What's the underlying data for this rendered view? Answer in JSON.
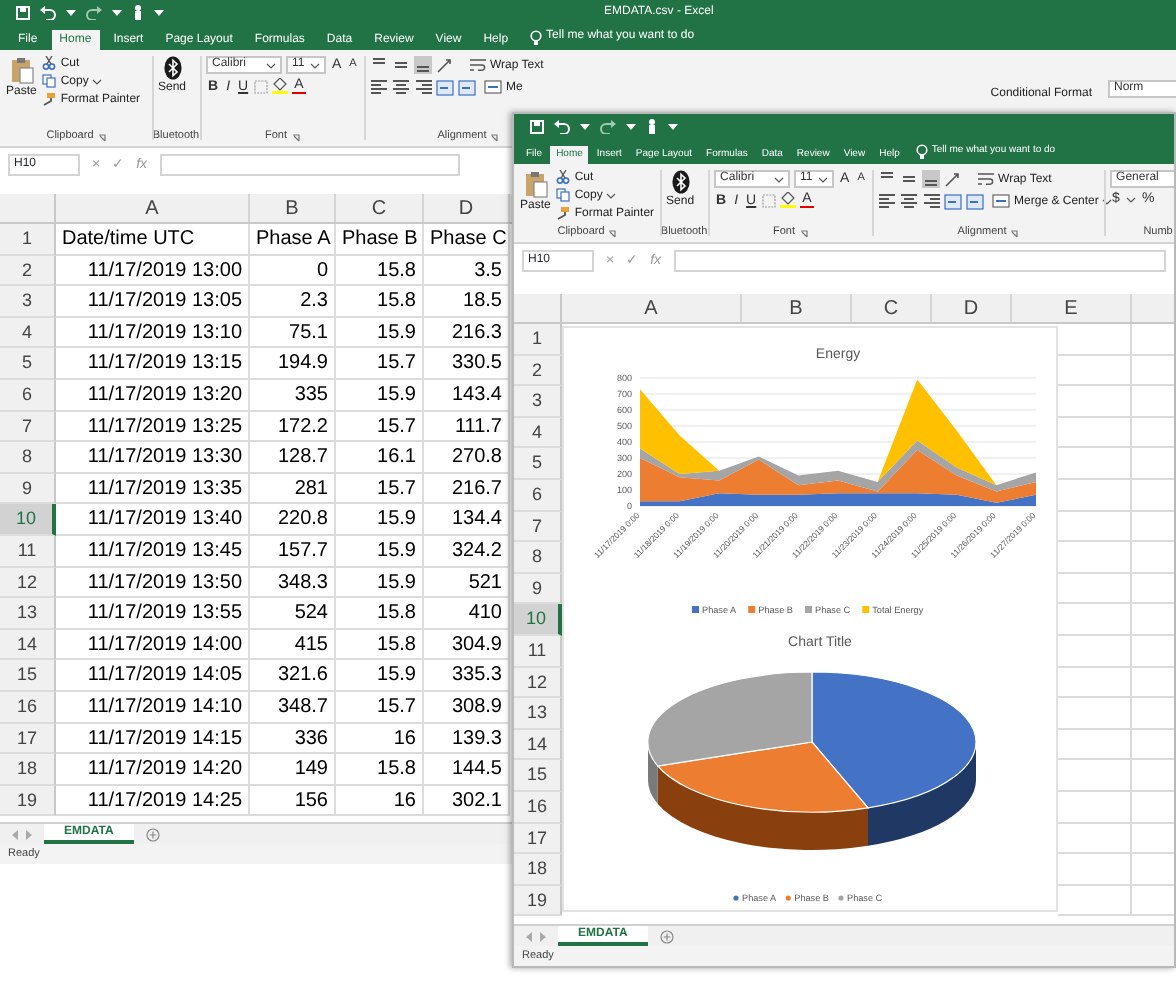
{
  "back_window": {
    "title": "EMDATA.csv - Excel",
    "tabs": [
      {
        "label": "File",
        "selected": false
      },
      {
        "label": "Home",
        "selected": true
      },
      {
        "label": "Insert",
        "selected": false
      },
      {
        "label": "Page Layout",
        "selected": false
      },
      {
        "label": "Formulas",
        "selected": false
      },
      {
        "label": "Data",
        "selected": false
      },
      {
        "label": "Review",
        "selected": false
      },
      {
        "label": "View",
        "selected": false
      },
      {
        "label": "Help",
        "selected": false
      }
    ],
    "tell_me": "Tell me what you want to do",
    "ribbon": {
      "clipboard": {
        "paste": "Paste",
        "cut": "Cut",
        "copy": "Copy",
        "format_painter": "Format Painter",
        "label": "Clipboard"
      },
      "bluetooth": {
        "send": "Send",
        "label": "Bluetooth"
      },
      "font": {
        "name": "Calibri",
        "size": "11",
        "grow": "A",
        "shrink": "A",
        "bold": "B",
        "italic": "I",
        "underline": "U",
        "text_color_button": "A",
        "label": "Font"
      },
      "alignment": {
        "wrap": "Wrap Text",
        "merge": "Me",
        "label": "Alignment"
      },
      "styles": {
        "conditional": "Conditional Format",
        "style_box": "Norm"
      }
    },
    "formula_bar": {
      "name_box": "H10",
      "cancel": "×",
      "enter": "✓",
      "fx": "fx"
    },
    "columns": [
      "A",
      "B",
      "C",
      "D"
    ],
    "rows": [
      {
        "number": "1",
        "selected": false,
        "cells": [
          "Date/time UTC",
          "Phase A",
          "Phase B",
          "Phase C"
        ]
      },
      {
        "number": "2",
        "selected": false,
        "cells": [
          "11/17/2019 13:00",
          "0",
          "15.8",
          "3.5"
        ]
      },
      {
        "number": "3",
        "selected": false,
        "cells": [
          "11/17/2019 13:05",
          "2.3",
          "15.8",
          "18.5"
        ]
      },
      {
        "number": "4",
        "selected": false,
        "cells": [
          "11/17/2019 13:10",
          "75.1",
          "15.9",
          "216.3"
        ]
      },
      {
        "number": "5",
        "selected": false,
        "cells": [
          "11/17/2019 13:15",
          "194.9",
          "15.7",
          "330.5"
        ]
      },
      {
        "number": "6",
        "selected": false,
        "cells": [
          "11/17/2019 13:20",
          "335",
          "15.9",
          "143.4"
        ]
      },
      {
        "number": "7",
        "selected": false,
        "cells": [
          "11/17/2019 13:25",
          "172.2",
          "15.7",
          "111.7"
        ]
      },
      {
        "number": "8",
        "selected": false,
        "cells": [
          "11/17/2019 13:30",
          "128.7",
          "16.1",
          "270.8"
        ]
      },
      {
        "number": "9",
        "selected": false,
        "cells": [
          "11/17/2019 13:35",
          "281",
          "15.7",
          "216.7"
        ]
      },
      {
        "number": "10",
        "selected": true,
        "cells": [
          "11/17/2019 13:40",
          "220.8",
          "15.9",
          "134.4"
        ]
      },
      {
        "number": "11",
        "selected": false,
        "cells": [
          "11/17/2019 13:45",
          "157.7",
          "15.9",
          "324.2"
        ]
      },
      {
        "number": "12",
        "selected": false,
        "cells": [
          "11/17/2019 13:50",
          "348.3",
          "15.9",
          "521"
        ]
      },
      {
        "number": "13",
        "selected": false,
        "cells": [
          "11/17/2019 13:55",
          "524",
          "15.8",
          "410"
        ]
      },
      {
        "number": "14",
        "selected": false,
        "cells": [
          "11/17/2019 14:00",
          "415",
          "15.8",
          "304.9"
        ]
      },
      {
        "number": "15",
        "selected": false,
        "cells": [
          "11/17/2019 14:05",
          "321.6",
          "15.9",
          "335.3"
        ]
      },
      {
        "number": "16",
        "selected": false,
        "cells": [
          "11/17/2019 14:10",
          "348.7",
          "15.7",
          "308.9"
        ]
      },
      {
        "number": "17",
        "selected": false,
        "cells": [
          "11/17/2019 14:15",
          "336",
          "16",
          "139.3"
        ]
      },
      {
        "number": "18",
        "selected": false,
        "cells": [
          "11/17/2019 14:20",
          "149",
          "15.8",
          "144.5"
        ]
      },
      {
        "number": "19",
        "selected": false,
        "cells": [
          "11/17/2019 14:25",
          "156",
          "16",
          "302.1"
        ]
      }
    ],
    "sheet_tabs": [
      {
        "label": "EMDATA",
        "selected": true
      }
    ],
    "status": "Ready"
  },
  "front_window": {
    "tabs": [
      {
        "label": "File",
        "selected": false
      },
      {
        "label": "Home",
        "selected": true
      },
      {
        "label": "Insert",
        "selected": false
      },
      {
        "label": "Page Layout",
        "selected": false
      },
      {
        "label": "Formulas",
        "selected": false
      },
      {
        "label": "Data",
        "selected": false
      },
      {
        "label": "Review",
        "selected": false
      },
      {
        "label": "View",
        "selected": false
      },
      {
        "label": "Help",
        "selected": false
      }
    ],
    "tell_me": "Tell me what you want to do",
    "ribbon": {
      "clipboard": {
        "paste": "Paste",
        "cut": "Cut",
        "copy": "Copy",
        "format_painter": "Format Painter",
        "label": "Clipboard"
      },
      "bluetooth": {
        "send": "Send",
        "label": "Bluetooth"
      },
      "font": {
        "name": "Calibri",
        "size": "11",
        "grow": "A",
        "shrink": "A",
        "bold": "B",
        "italic": "I",
        "underline": "U",
        "text_color_button": "A",
        "label": "Font"
      },
      "alignment": {
        "wrap": "Wrap Text",
        "merge": "Merge & Center",
        "label": "Alignment"
      },
      "number": {
        "format": "General",
        "currency": "$",
        "percent": "%",
        "label": "Numb"
      }
    },
    "formula_bar": {
      "name_box": "H10",
      "cancel": "×",
      "enter": "✓",
      "fx": "fx"
    },
    "columns": [
      "A",
      "B",
      "C",
      "D",
      "E"
    ],
    "rows": [
      {
        "number": "1",
        "selected": false
      },
      {
        "number": "2",
        "selected": false
      },
      {
        "number": "3",
        "selected": false
      },
      {
        "number": "4",
        "selected": false
      },
      {
        "number": "5",
        "selected": false
      },
      {
        "number": "6",
        "selected": false
      },
      {
        "number": "7",
        "selected": false
      },
      {
        "number": "8",
        "selected": false
      },
      {
        "number": "9",
        "selected": false
      },
      {
        "number": "10",
        "selected": true
      },
      {
        "number": "11",
        "selected": false
      },
      {
        "number": "12",
        "selected": false
      },
      {
        "number": "13",
        "selected": false
      },
      {
        "number": "14",
        "selected": false
      },
      {
        "number": "15",
        "selected": false
      },
      {
        "number": "16",
        "selected": false
      },
      {
        "number": "17",
        "selected": false
      },
      {
        "number": "18",
        "selected": false
      },
      {
        "number": "19",
        "selected": false
      }
    ],
    "energy_chart": {
      "chart_data": {
        "type": "area",
        "title": "Energy",
        "stacked": true,
        "grid": true,
        "legend": "bottom",
        "ylim": [
          0,
          800
        ],
        "yticks": [
          0,
          100,
          200,
          300,
          400,
          500,
          600,
          700,
          800
        ],
        "categories": [
          "11/17/2019 0:00",
          "11/18/2019 0:00",
          "11/19/2019 0:00",
          "11/20/2019 0:00",
          "11/21/2019 0:00",
          "11/22/2019 0:00",
          "11/23/2019 0:00",
          "11/24/2019 0:00",
          "11/25/2019 0:00",
          "11/26/2019 0:00",
          "11/27/2019 0:00"
        ],
        "series": [
          {
            "name": "Phase A",
            "color": "#4472c4",
            "values": [
              30,
              30,
              80,
              70,
              70,
              80,
              80,
              80,
              70,
              20,
              70
            ]
          },
          {
            "name": "Phase B",
            "color": "#ed7d31",
            "values": [
              270,
              150,
              80,
              220,
              60,
              80,
              10,
              270,
              120,
              70,
              80
            ]
          },
          {
            "name": "Phase C",
            "color": "#a5a5a5",
            "values": [
              60,
              20,
              60,
              20,
              60,
              60,
              60,
              60,
              50,
              40,
              60
            ]
          },
          {
            "name": "Total Energy",
            "color": "#ffc000",
            "values": [
              370,
              240,
              0,
              0,
              0,
              0,
              0,
              380,
              230,
              0,
              0
            ]
          }
        ]
      }
    },
    "pie_chart": {
      "title": "Chart Title",
      "legend": [
        {
          "name": "Phase A",
          "color": "#4472c4"
        },
        {
          "name": "Phase B",
          "color": "#ed7d31"
        },
        {
          "name": "Phase C",
          "color": "#a5a5a5"
        }
      ]
    },
    "sheet_tabs": [
      {
        "label": "EMDATA",
        "selected": true
      }
    ],
    "status": "Ready"
  }
}
